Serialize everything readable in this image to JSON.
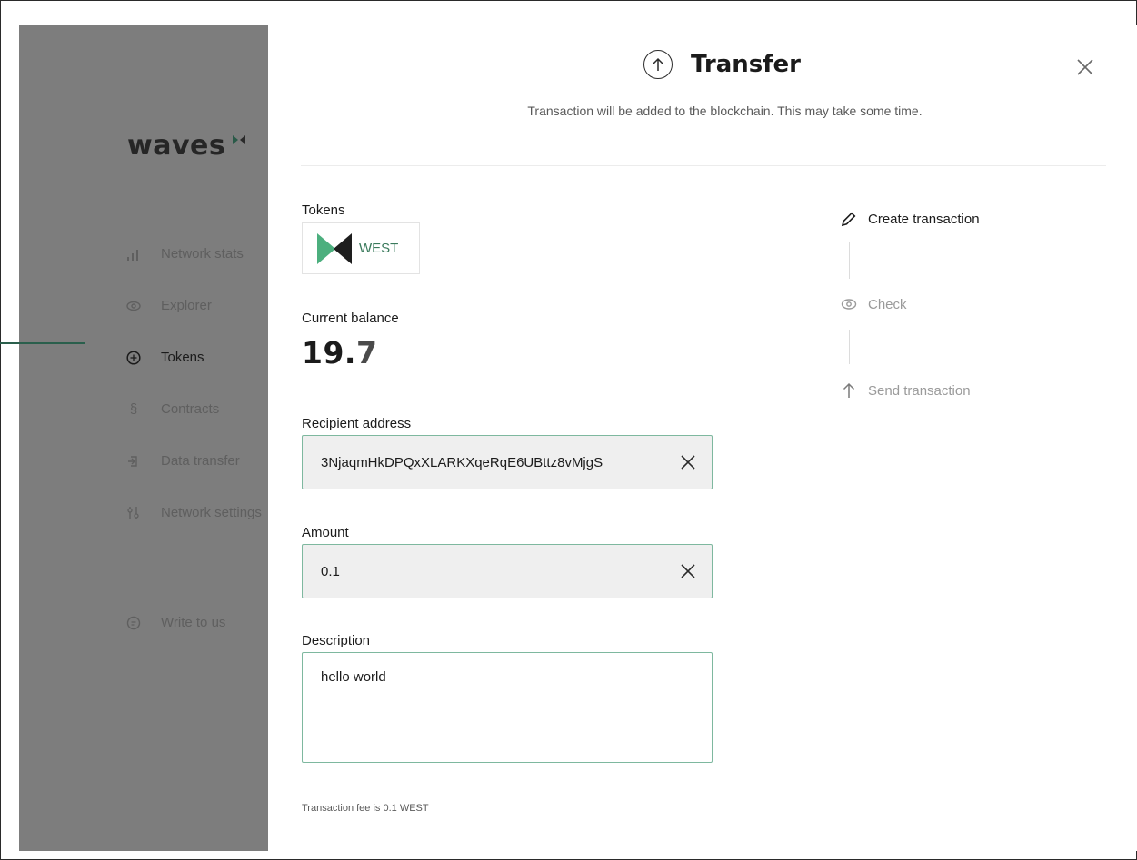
{
  "sidebar": {
    "logo_text": "waves",
    "items": [
      {
        "label": "Network stats",
        "icon": "bar-chart-icon",
        "active": false
      },
      {
        "label": "Explorer",
        "icon": "eye-icon",
        "active": false
      },
      {
        "label": "Tokens",
        "icon": "coin-icon",
        "active": true
      },
      {
        "label": "Contracts",
        "icon": "section-icon",
        "active": false
      },
      {
        "label": "Data transfer",
        "icon": "data-transfer-icon",
        "active": false
      },
      {
        "label": "Network settings",
        "icon": "sliders-icon",
        "active": false
      }
    ],
    "write_to_us": "Write to us"
  },
  "modal": {
    "title": "Transfer",
    "title_icon": "arrow-up-circle-icon",
    "subtitle": "Transaction will be added to the blockchain. This may take some time.",
    "tokens_label": "Tokens",
    "token_name": "WEST",
    "balance_label": "Current balance",
    "balance_int": "19.",
    "balance_dec": "7",
    "recipient_label": "Recipient address",
    "recipient_value": "3NjaqmHkDPQxXLARKXqeRqE6UBttz8vMjgS",
    "amount_label": "Amount",
    "amount_value": "0.1",
    "description_label": "Description",
    "description_value": "hello world",
    "fee_text": "Transaction fee is 0.1 WEST"
  },
  "steps": [
    {
      "label": "Create transaction",
      "icon": "pencil-icon",
      "state": "done"
    },
    {
      "label": "Check",
      "icon": "eye-icon",
      "state": "pending"
    },
    {
      "label": "Send transaction",
      "icon": "arrow-up-icon",
      "state": "pending"
    }
  ],
  "colors": {
    "accent": "#2a5f4c",
    "field_border": "#7eb89f",
    "overlay": "#7d7d7d"
  }
}
